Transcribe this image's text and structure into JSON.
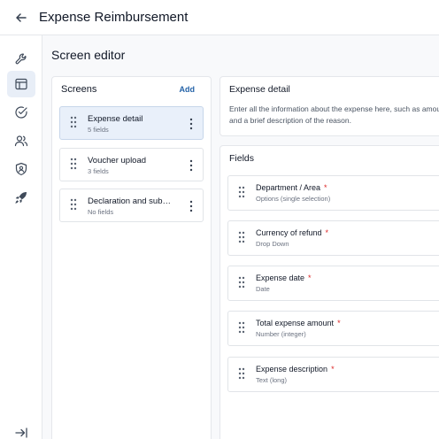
{
  "header": {
    "title": "Expense Reimbursement"
  },
  "rail": {
    "items": [
      {
        "icon": "wrench-icon"
      },
      {
        "icon": "layout-icon",
        "active": true
      },
      {
        "icon": "check-circle-icon"
      },
      {
        "icon": "users-icon"
      },
      {
        "icon": "shield-user-icon"
      },
      {
        "icon": "rocket-icon"
      }
    ],
    "bottom_icon": "collapse-sidebar-icon"
  },
  "editor": {
    "title": "Screen editor"
  },
  "screens": {
    "title": "Screens",
    "add_label": "Add",
    "items": [
      {
        "name": "Expense detail",
        "sub": "5 fields",
        "selected": true
      },
      {
        "name": "Voucher upload",
        "sub": "3 fields"
      },
      {
        "name": "Declaration and sub…",
        "sub": "No fields"
      }
    ]
  },
  "detail": {
    "title": "Expense detail",
    "description": "Enter all the information about the expense here, such as amount, and a brief description of the reason."
  },
  "fields": {
    "title": "Fields",
    "required_marker": "*",
    "items": [
      {
        "name": "Department / Area",
        "type": "Options (single selection)"
      },
      {
        "name": "Currency of refund",
        "type": "Drop Down"
      },
      {
        "name": "Expense date",
        "type": "Date"
      },
      {
        "name": "Total expense amount",
        "type": "Number (integer)"
      },
      {
        "name": "Expense description",
        "type": "Text (long)"
      }
    ]
  },
  "colors": {
    "accent": "#2563a8",
    "selected_bg": "#e9f0fa",
    "required": "#dc2626"
  }
}
